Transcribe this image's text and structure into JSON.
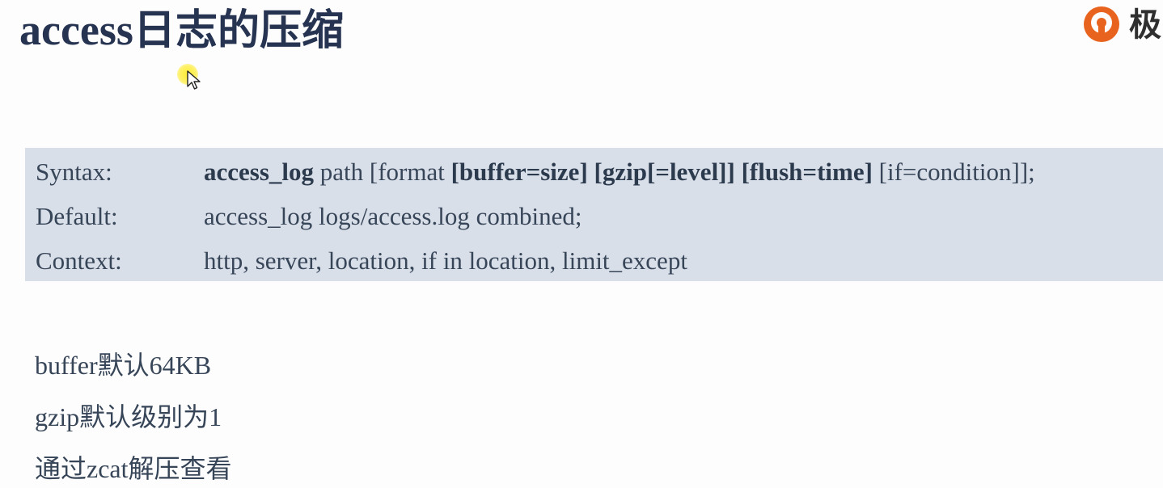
{
  "title": {
    "latin": "access",
    "cjk": "日志的压缩"
  },
  "logo": {
    "text": "极",
    "icon": "q-logo-icon",
    "accent": "#e8641e"
  },
  "directive": {
    "rows": [
      {
        "key": "Syntax:",
        "segments": [
          {
            "text": "access_log",
            "bold": true
          },
          {
            "text": " path [format ",
            "bold": false
          },
          {
            "text": "[buffer=size]",
            "bold": true
          },
          {
            "text": " ",
            "bold": false
          },
          {
            "text": "[gzip[=level]]",
            "bold": true
          },
          {
            "text": " ",
            "bold": false
          },
          {
            "text": "[flush=time]",
            "bold": true
          },
          {
            "text": " [if=condition]];",
            "bold": false
          }
        ]
      },
      {
        "key": "Default:",
        "segments": [
          {
            "text": "access_log logs/access.log combined;",
            "bold": false
          }
        ]
      },
      {
        "key": "Context:",
        "segments": [
          {
            "text": "http, server, location, if in location, limit_except",
            "bold": false
          }
        ]
      }
    ],
    "background": "#d9dfe9"
  },
  "notes": [
    "buffer默认64KB",
    "gzip默认级别为1",
    "通过zcat解压查看"
  ],
  "colors": {
    "title": "#263452",
    "text": "#374558",
    "cursor_highlight": "#ffec28"
  }
}
